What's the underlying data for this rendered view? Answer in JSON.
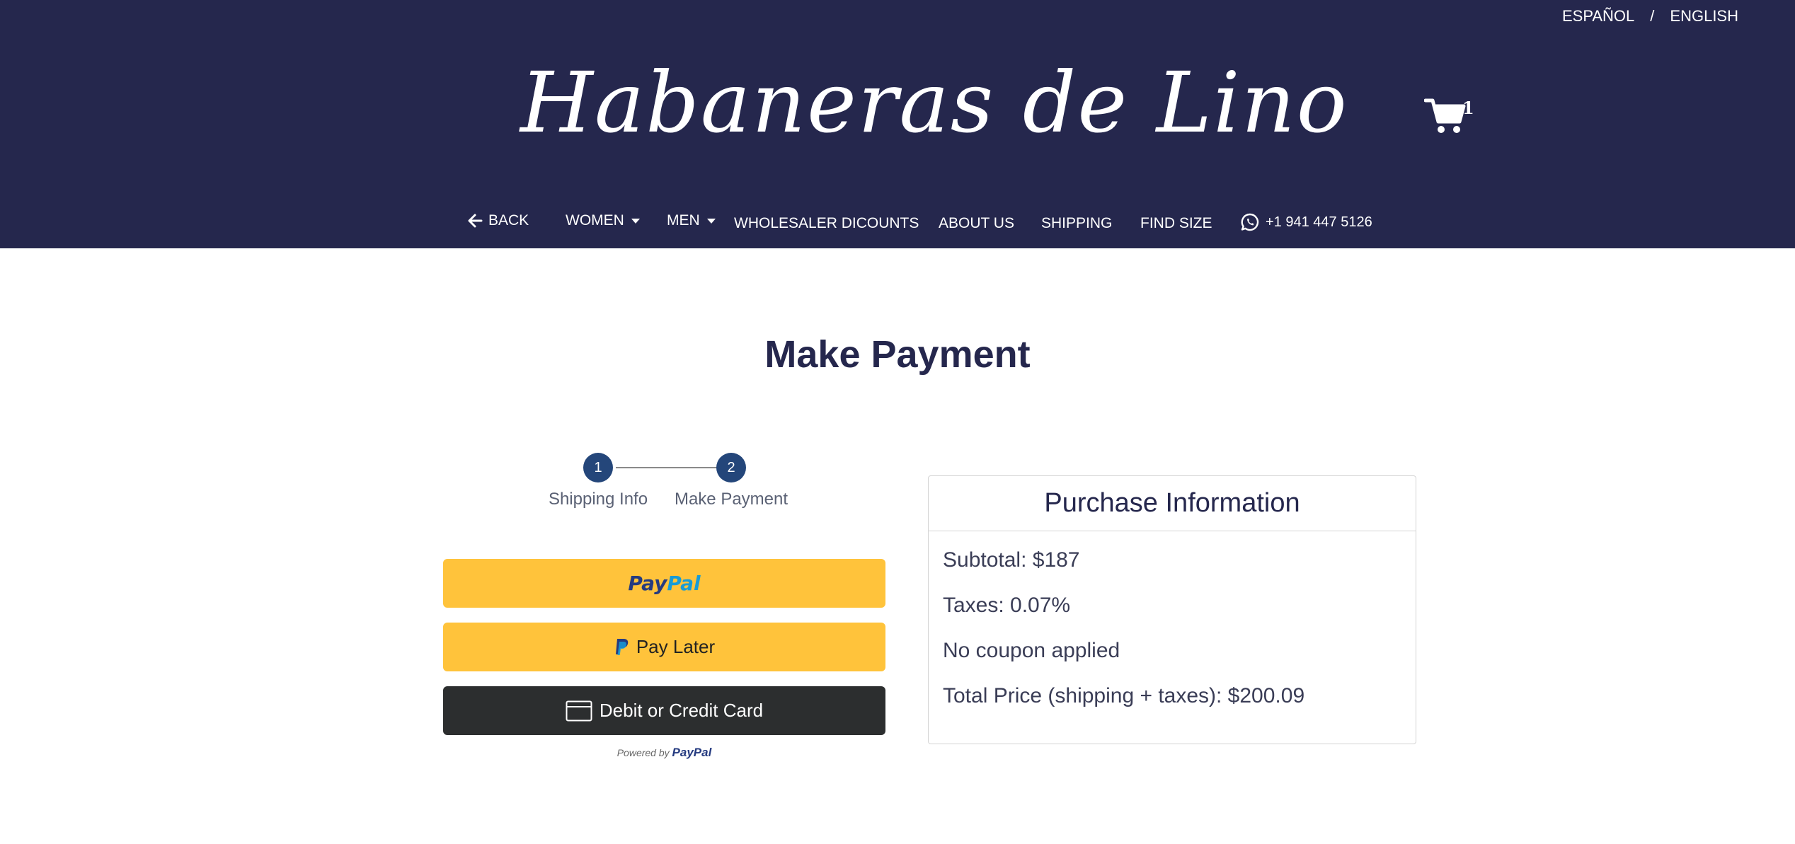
{
  "header": {
    "lang_es": "ESPAÑOL",
    "lang_sep": "/",
    "lang_en": "ENGLISH",
    "logo_text": "Habaneras de Lino",
    "cart_count": "1",
    "bg_color": "#25274d"
  },
  "nav": {
    "back": "BACK",
    "women": "WOMEN",
    "men": "MEN",
    "wholesaler": "WHOLESALER DICOUNTS",
    "about": "ABOUT US",
    "shipping": "SHIPPING",
    "find_size": "FIND SIZE",
    "phone": "+1 941 447 5126"
  },
  "main": {
    "title": "Make Payment"
  },
  "stepper": {
    "steps": [
      {
        "number": "1",
        "label": "Shipping Info"
      },
      {
        "number": "2",
        "label": "Make Payment"
      }
    ]
  },
  "payment": {
    "paypal_a": "Pay",
    "paypal_b": "Pal",
    "pay_later": "Pay Later",
    "card": "Debit or Credit Card",
    "powered_by": "Powered by",
    "powered_brand": "PayPal",
    "button_color": "#ffc33b",
    "card_color": "#2c2e2f"
  },
  "purchase": {
    "title": "Purchase Information",
    "subtotal": "Subtotal: $187",
    "taxes": "Taxes: 0.07%",
    "coupon": "No coupon applied",
    "total": "Total Price (shipping + taxes): $200.09"
  }
}
